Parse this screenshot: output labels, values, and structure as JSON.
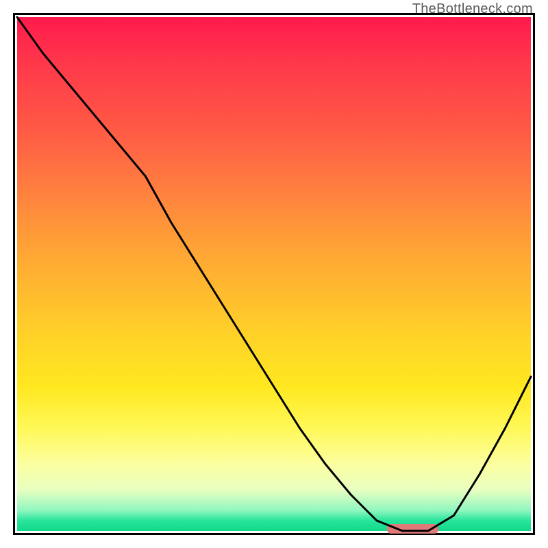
{
  "watermark": "TheBottleneck.com",
  "chart_data": {
    "type": "line",
    "title": "",
    "xlabel": "",
    "ylabel": "",
    "x": [
      0.0,
      0.05,
      0.1,
      0.15,
      0.2,
      0.25,
      0.3,
      0.35,
      0.4,
      0.45,
      0.5,
      0.55,
      0.6,
      0.65,
      0.7,
      0.75,
      0.8,
      0.85,
      0.9,
      0.95,
      1.0
    ],
    "values": [
      100,
      93,
      87,
      81,
      75,
      69,
      60,
      52,
      44,
      36,
      28,
      20,
      13,
      7,
      2,
      0,
      0,
      3,
      11,
      20,
      30
    ],
    "xlim": [
      0,
      1
    ],
    "ylim": [
      0,
      100
    ],
    "gradient_stops": [
      {
        "pos": 0.0,
        "color": "#ff1a4d"
      },
      {
        "pos": 0.5,
        "color": "#ffb730"
      },
      {
        "pos": 0.8,
        "color": "#fff858"
      },
      {
        "pos": 0.95,
        "color": "#90f7c0"
      },
      {
        "pos": 1.0,
        "color": "#12d98c"
      }
    ],
    "marker": {
      "x_start": 0.72,
      "x_end": 0.82,
      "y": 0,
      "color": "#df7a79"
    }
  }
}
